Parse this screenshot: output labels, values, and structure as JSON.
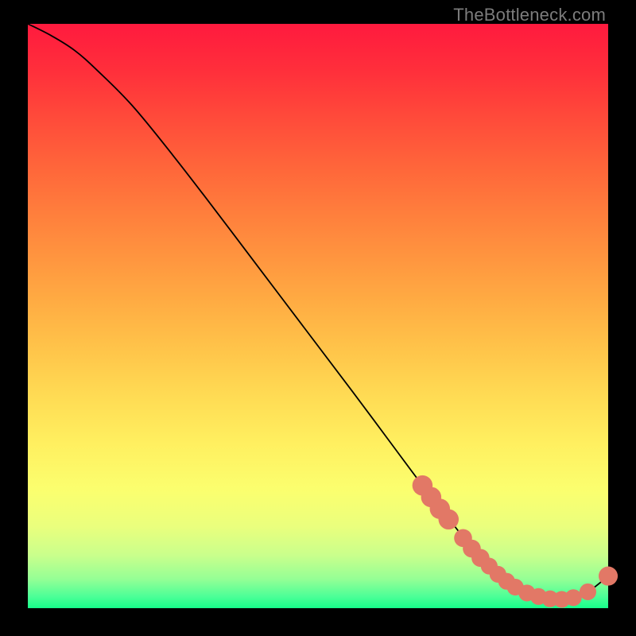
{
  "watermark": "TheBottleneck.com",
  "colors": {
    "background": "#000000",
    "curve": "#000000",
    "dot_fill": "#e27866",
    "dot_stroke": "#d96a58"
  },
  "chart_data": {
    "type": "line",
    "title": "",
    "xlabel": "",
    "ylabel": "",
    "xlim": [
      0,
      100
    ],
    "ylim": [
      0,
      100
    ],
    "grid": false,
    "legend": false,
    "series": [
      {
        "name": "bottleneck-curve",
        "x": [
          0,
          4,
          8,
          12,
          18,
          25,
          32,
          40,
          48,
          56,
          62,
          68,
          72,
          76,
          80,
          84,
          88,
          92,
          96,
          100
        ],
        "y": [
          100,
          98,
          95.5,
          92,
          86,
          77.5,
          68.5,
          58,
          47.5,
          37,
          29,
          21,
          16,
          11,
          7,
          4,
          2,
          1.5,
          2.5,
          5.5
        ]
      }
    ],
    "scatter_overlay": {
      "name": "markers",
      "points": [
        {
          "x": 68,
          "y": 21,
          "r": 1.2
        },
        {
          "x": 69.5,
          "y": 19,
          "r": 1.2
        },
        {
          "x": 71,
          "y": 17,
          "r": 1.2
        },
        {
          "x": 72.5,
          "y": 15.2,
          "r": 1.2
        },
        {
          "x": 75,
          "y": 12,
          "r": 1.0
        },
        {
          "x": 76.5,
          "y": 10.2,
          "r": 1.0
        },
        {
          "x": 78,
          "y": 8.6,
          "r": 1.0
        },
        {
          "x": 79.5,
          "y": 7.2,
          "r": 0.9
        },
        {
          "x": 81,
          "y": 5.8,
          "r": 0.9
        },
        {
          "x": 82.5,
          "y": 4.6,
          "r": 0.9
        },
        {
          "x": 84,
          "y": 3.6,
          "r": 0.9
        },
        {
          "x": 86,
          "y": 2.6,
          "r": 0.9
        },
        {
          "x": 88,
          "y": 2.0,
          "r": 0.9
        },
        {
          "x": 90,
          "y": 1.6,
          "r": 0.9
        },
        {
          "x": 92,
          "y": 1.5,
          "r": 0.9
        },
        {
          "x": 94,
          "y": 1.8,
          "r": 0.9
        },
        {
          "x": 96.5,
          "y": 2.8,
          "r": 0.9
        },
        {
          "x": 100,
          "y": 5.5,
          "r": 1.1
        }
      ]
    }
  }
}
